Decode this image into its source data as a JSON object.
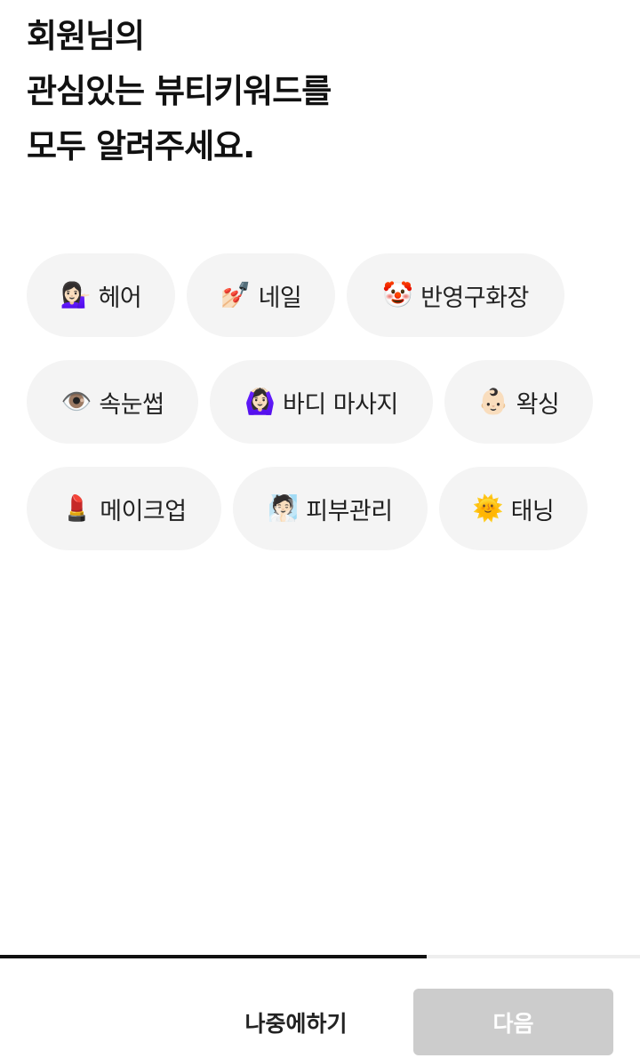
{
  "header": {
    "title_lines": [
      "회원님의",
      "관심있는 뷰티키워드를",
      "모두 알려주세요."
    ]
  },
  "keywords": [
    {
      "emoji": "💁🏻‍♀️",
      "label": "헤어"
    },
    {
      "emoji": "💅🏻",
      "label": "네일"
    },
    {
      "emoji": "🤡",
      "label": "반영구화장"
    },
    {
      "emoji": "👁️",
      "label": "속눈썹"
    },
    {
      "emoji": "🙆🏻‍♀️",
      "label": "바디 마사지"
    },
    {
      "emoji": "👶🏻",
      "label": "왁싱"
    },
    {
      "emoji": "💄",
      "label": "메이크업"
    },
    {
      "emoji": "🧖🏻",
      "label": "피부관리"
    },
    {
      "emoji": "🌞",
      "label": "태닝"
    }
  ],
  "progress": {
    "fraction": 0.667,
    "fill_color": "#111111",
    "track_color": "#eeeeee"
  },
  "footer": {
    "later_label": "나중에하기",
    "next_label": "다음",
    "next_disabled_color": "#cccccc"
  },
  "colors": {
    "chip_background": "#f4f4f4",
    "text": "#111111"
  }
}
